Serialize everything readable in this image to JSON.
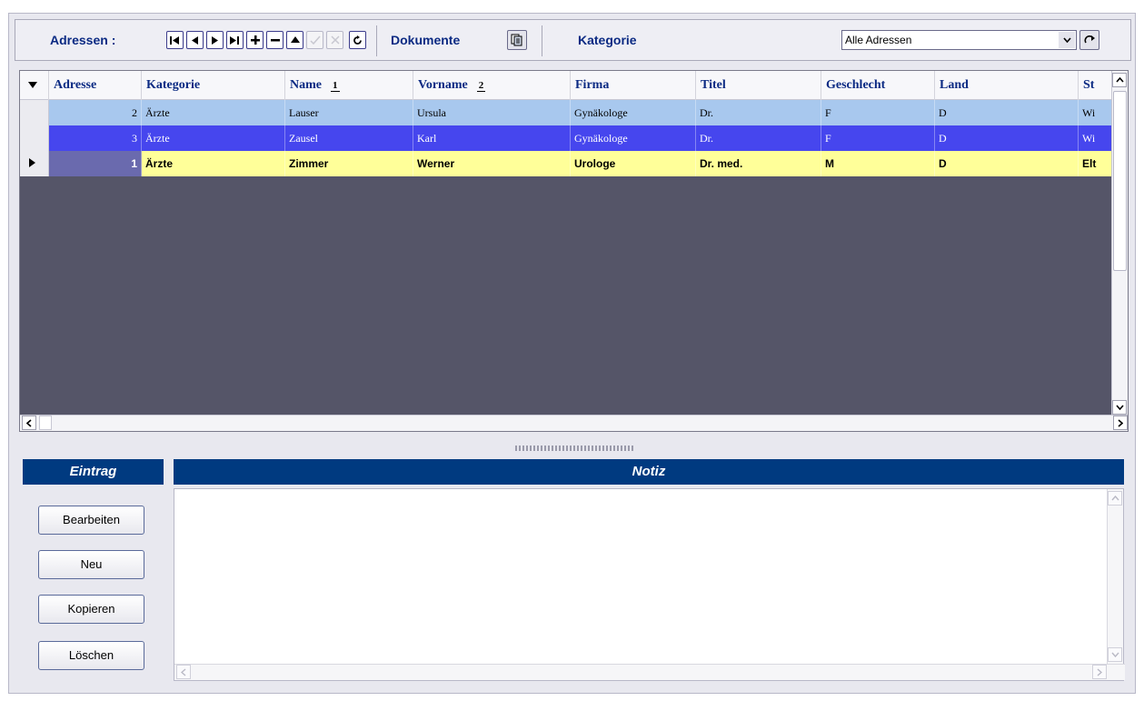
{
  "toolbar": {
    "adressen_label": "Adressen :",
    "dokumente_label": "Dokumente",
    "kategorie_label": "Kategorie",
    "kategorie_value": "Alle Adressen",
    "nav_buttons": [
      "first-record-icon",
      "previous-record-icon",
      "next-record-icon",
      "last-record-icon",
      "add-record-icon",
      "delete-record-icon",
      "edit-record-icon",
      "post-icon",
      "cancel-icon",
      "refresh-icon"
    ],
    "document_icon": "documents-icon",
    "refresh_category_icon": "refresh-category-icon"
  },
  "grid": {
    "columns": [
      "Adresse",
      "Kategorie",
      "Name",
      "Vorname",
      "Firma",
      "Titel",
      "Geschlecht",
      "Land",
      "St"
    ],
    "sort_markers": {
      "Name": "1",
      "Vorname": "2"
    },
    "rows": [
      {
        "adresse": "2",
        "kategorie": "Ärzte",
        "name": "Lauser",
        "vorname": "Ursula",
        "firma": "Gynäkologe",
        "titel": "Dr.",
        "geschlecht": "F",
        "land": "D",
        "st": "Wi"
      },
      {
        "adresse": "3",
        "kategorie": "Ärzte",
        "name": "Zausel",
        "vorname": "Karl",
        "firma": "Gynäkologe",
        "titel": "Dr.",
        "geschlecht": "F",
        "land": "D",
        "st": "Wi"
      },
      {
        "adresse": "1",
        "kategorie": "Ärzte",
        "name": "Zimmer",
        "vorname": "Werner",
        "firma": "Urologe",
        "titel": "Dr. med.",
        "geschlecht": "M",
        "land": "D",
        "st": "Elt"
      }
    ],
    "colors": {
      "row_selected_light": "#a8c8ee",
      "row_selected_dark": "#4646ee",
      "row_current": "#ffff99",
      "grid_background": "#555568"
    }
  },
  "eintrag": {
    "title": "Eintrag",
    "buttons": {
      "bearbeiten": "Bearbeiten",
      "neu": "Neu",
      "kopieren": "Kopieren",
      "loeschen": "Löschen"
    }
  },
  "notiz": {
    "title": "Notiz",
    "text": ""
  },
  "colors": {
    "panel_header": "#003a80",
    "label_blue": "#0b2a83"
  }
}
